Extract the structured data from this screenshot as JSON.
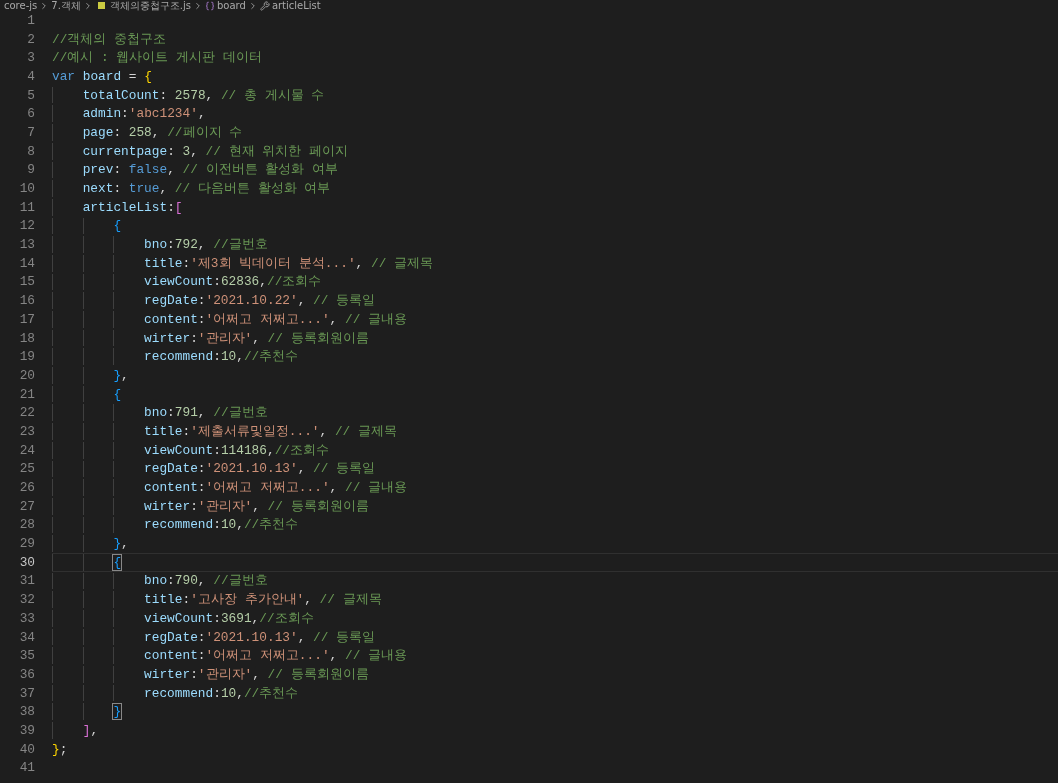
{
  "breadcrumb": [
    {
      "kind": "folder",
      "text": "core-js"
    },
    {
      "kind": "folder",
      "text": "7.객체"
    },
    {
      "kind": "file",
      "text": "객체의중첩구조.js"
    },
    {
      "kind": "variable",
      "text": "board"
    },
    {
      "kind": "property",
      "text": "articleList"
    }
  ],
  "editor": {
    "lines": [
      {
        "number": "1",
        "current": false
      },
      {
        "number": "2",
        "current": false,
        "tokens": [
          {
            "kind": "comment",
            "text": "//객체의 중첩구조"
          }
        ]
      },
      {
        "number": "3",
        "current": false,
        "tokens": [
          {
            "kind": "comment",
            "text": "//예시 : 웹사이트 게시판 데이터"
          }
        ]
      },
      {
        "number": "4",
        "current": false,
        "tokens": [
          {
            "kind": "keyword",
            "text": "var "
          },
          {
            "kind": "property",
            "text": "board"
          },
          {
            "kind": "punct",
            "text": " = "
          },
          {
            "kind": "bracket",
            "text": "{",
            "color": "#ffd700",
            "matched": false
          }
        ],
        "children": [
          {
            "number": "5",
            "current": false,
            "tokens": [
              {
                "kind": "property",
                "text": "totalCount"
              },
              {
                "kind": "punct",
                "text": ": "
              },
              {
                "kind": "number",
                "text": "2578"
              },
              {
                "kind": "punct",
                "text": ", "
              },
              {
                "kind": "comment",
                "text": "// 총 게시물 수"
              }
            ]
          },
          {
            "number": "6",
            "current": false,
            "tokens": [
              {
                "kind": "property",
                "text": "admin"
              },
              {
                "kind": "punct",
                "text": ":"
              },
              {
                "kind": "string",
                "text": "'abc1234'"
              },
              {
                "kind": "punct",
                "text": ","
              }
            ]
          },
          {
            "number": "7",
            "current": false,
            "tokens": [
              {
                "kind": "property",
                "text": "page"
              },
              {
                "kind": "punct",
                "text": ": "
              },
              {
                "kind": "number",
                "text": "258"
              },
              {
                "kind": "punct",
                "text": ", "
              },
              {
                "kind": "comment",
                "text": "//페이지 수"
              }
            ]
          },
          {
            "number": "8",
            "current": false,
            "tokens": [
              {
                "kind": "property",
                "text": "currentpage"
              },
              {
                "kind": "punct",
                "text": ": "
              },
              {
                "kind": "number",
                "text": "3"
              },
              {
                "kind": "punct",
                "text": ", "
              },
              {
                "kind": "comment",
                "text": "// 현재 위치한 페이지"
              }
            ]
          },
          {
            "number": "9",
            "current": false,
            "tokens": [
              {
                "kind": "property",
                "text": "prev"
              },
              {
                "kind": "punct",
                "text": ": "
              },
              {
                "kind": "keyword",
                "text": "false"
              },
              {
                "kind": "punct",
                "text": ", "
              },
              {
                "kind": "comment",
                "text": "// 이전버튼 활성화 여부"
              }
            ]
          },
          {
            "number": "10",
            "current": false,
            "tokens": [
              {
                "kind": "property",
                "text": "next"
              },
              {
                "kind": "punct",
                "text": ": "
              },
              {
                "kind": "keyword",
                "text": "true"
              },
              {
                "kind": "punct",
                "text": ", "
              },
              {
                "kind": "comment",
                "text": "// 다음버튼 활성화 여부"
              }
            ]
          },
          {
            "number": "11",
            "current": false,
            "tokens": [
              {
                "kind": "property",
                "text": "articleList"
              },
              {
                "kind": "punct",
                "text": ":"
              },
              {
                "kind": "bracket",
                "text": "[",
                "color": "#da70d6",
                "matched": false
              }
            ],
            "children": [
              {
                "number": "12",
                "current": false,
                "tokens": [
                  {
                    "kind": "bracket",
                    "text": "{",
                    "color": "#179fff",
                    "matched": false
                  }
                ],
                "children": [
                  {
                    "number": "13",
                    "current": false,
                    "tokens": [
                      {
                        "kind": "property",
                        "text": "bno"
                      },
                      {
                        "kind": "punct",
                        "text": ":"
                      },
                      {
                        "kind": "number",
                        "text": "792"
                      },
                      {
                        "kind": "punct",
                        "text": ", "
                      },
                      {
                        "kind": "comment",
                        "text": "//글번호"
                      }
                    ]
                  },
                  {
                    "number": "14",
                    "current": false,
                    "tokens": [
                      {
                        "kind": "property",
                        "text": "title"
                      },
                      {
                        "kind": "punct",
                        "text": ":"
                      },
                      {
                        "kind": "string",
                        "text": "'제3회 빅데이터 분석...'"
                      },
                      {
                        "kind": "punct",
                        "text": ", "
                      },
                      {
                        "kind": "comment",
                        "text": "// 글제목"
                      }
                    ]
                  },
                  {
                    "number": "15",
                    "current": false,
                    "tokens": [
                      {
                        "kind": "property",
                        "text": "viewCount"
                      },
                      {
                        "kind": "punct",
                        "text": ":"
                      },
                      {
                        "kind": "number",
                        "text": "62836"
                      },
                      {
                        "kind": "punct",
                        "text": ","
                      },
                      {
                        "kind": "comment",
                        "text": "//조회수"
                      }
                    ]
                  },
                  {
                    "number": "16",
                    "current": false,
                    "tokens": [
                      {
                        "kind": "property",
                        "text": "regDate"
                      },
                      {
                        "kind": "punct",
                        "text": ":"
                      },
                      {
                        "kind": "string",
                        "text": "'2021.10.22'"
                      },
                      {
                        "kind": "punct",
                        "text": ", "
                      },
                      {
                        "kind": "comment",
                        "text": "// 등록일"
                      }
                    ]
                  },
                  {
                    "number": "17",
                    "current": false,
                    "tokens": [
                      {
                        "kind": "property",
                        "text": "content"
                      },
                      {
                        "kind": "punct",
                        "text": ":"
                      },
                      {
                        "kind": "string",
                        "text": "'어쩌고 저쩌고...'"
                      },
                      {
                        "kind": "punct",
                        "text": ", "
                      },
                      {
                        "kind": "comment",
                        "text": "// 글내용"
                      }
                    ]
                  },
                  {
                    "number": "18",
                    "current": false,
                    "tokens": [
                      {
                        "kind": "property",
                        "text": "wirter"
                      },
                      {
                        "kind": "punct",
                        "text": ":"
                      },
                      {
                        "kind": "string",
                        "text": "'관리자'"
                      },
                      {
                        "kind": "punct",
                        "text": ", "
                      },
                      {
                        "kind": "comment",
                        "text": "// 등록회원이름"
                      }
                    ]
                  },
                  {
                    "number": "19",
                    "current": false,
                    "tokens": [
                      {
                        "kind": "property",
                        "text": "recommend"
                      },
                      {
                        "kind": "punct",
                        "text": ":"
                      },
                      {
                        "kind": "number",
                        "text": "10"
                      },
                      {
                        "kind": "punct",
                        "text": ","
                      },
                      {
                        "kind": "comment",
                        "text": "//추천수"
                      }
                    ]
                  }
                ]
              },
              {
                "number": "20",
                "current": false,
                "tokens": [
                  {
                    "kind": "bracket",
                    "text": "}",
                    "color": "#179fff",
                    "matched": false
                  },
                  {
                    "kind": "punct",
                    "text": ","
                  }
                ]
              },
              {
                "number": "21",
                "current": false,
                "tokens": [
                  {
                    "kind": "bracket",
                    "text": "{",
                    "color": "#179fff",
                    "matched": false
                  }
                ],
                "children": [
                  {
                    "number": "22",
                    "current": false,
                    "tokens": [
                      {
                        "kind": "property",
                        "text": "bno"
                      },
                      {
                        "kind": "punct",
                        "text": ":"
                      },
                      {
                        "kind": "number",
                        "text": "791"
                      },
                      {
                        "kind": "punct",
                        "text": ", "
                      },
                      {
                        "kind": "comment",
                        "text": "//글번호"
                      }
                    ]
                  },
                  {
                    "number": "23",
                    "current": false,
                    "tokens": [
                      {
                        "kind": "property",
                        "text": "title"
                      },
                      {
                        "kind": "punct",
                        "text": ":"
                      },
                      {
                        "kind": "string",
                        "text": "'제출서류및일정...'"
                      },
                      {
                        "kind": "punct",
                        "text": ", "
                      },
                      {
                        "kind": "comment",
                        "text": "// 글제목"
                      }
                    ]
                  },
                  {
                    "number": "24",
                    "current": false,
                    "tokens": [
                      {
                        "kind": "property",
                        "text": "viewCount"
                      },
                      {
                        "kind": "punct",
                        "text": ":"
                      },
                      {
                        "kind": "number",
                        "text": "114186"
                      },
                      {
                        "kind": "punct",
                        "text": ","
                      },
                      {
                        "kind": "comment",
                        "text": "//조회수"
                      }
                    ]
                  },
                  {
                    "number": "25",
                    "current": false,
                    "tokens": [
                      {
                        "kind": "property",
                        "text": "regDate"
                      },
                      {
                        "kind": "punct",
                        "text": ":"
                      },
                      {
                        "kind": "string",
                        "text": "'2021.10.13'"
                      },
                      {
                        "kind": "punct",
                        "text": ", "
                      },
                      {
                        "kind": "comment",
                        "text": "// 등록일"
                      }
                    ]
                  },
                  {
                    "number": "26",
                    "current": false,
                    "tokens": [
                      {
                        "kind": "property",
                        "text": "content"
                      },
                      {
                        "kind": "punct",
                        "text": ":"
                      },
                      {
                        "kind": "string",
                        "text": "'어쩌고 저쩌고...'"
                      },
                      {
                        "kind": "punct",
                        "text": ", "
                      },
                      {
                        "kind": "comment",
                        "text": "// 글내용"
                      }
                    ]
                  },
                  {
                    "number": "27",
                    "current": false,
                    "tokens": [
                      {
                        "kind": "property",
                        "text": "wirter"
                      },
                      {
                        "kind": "punct",
                        "text": ":"
                      },
                      {
                        "kind": "string",
                        "text": "'관리자'"
                      },
                      {
                        "kind": "punct",
                        "text": ", "
                      },
                      {
                        "kind": "comment",
                        "text": "// 등록회원이름"
                      }
                    ]
                  },
                  {
                    "number": "28",
                    "current": false,
                    "tokens": [
                      {
                        "kind": "property",
                        "text": "recommend"
                      },
                      {
                        "kind": "punct",
                        "text": ":"
                      },
                      {
                        "kind": "number",
                        "text": "10"
                      },
                      {
                        "kind": "punct",
                        "text": ","
                      },
                      {
                        "kind": "comment",
                        "text": "//추천수"
                      }
                    ]
                  }
                ]
              },
              {
                "number": "29",
                "current": false,
                "tokens": [
                  {
                    "kind": "bracket",
                    "text": "}",
                    "color": "#179fff",
                    "matched": false
                  },
                  {
                    "kind": "punct",
                    "text": ","
                  }
                ]
              },
              {
                "number": "30",
                "current": true,
                "tokens": [
                  {
                    "kind": "bracket",
                    "text": "{",
                    "color": "#179fff",
                    "matched": true
                  }
                ],
                "children": [
                  {
                    "number": "31",
                    "current": false,
                    "tokens": [
                      {
                        "kind": "property",
                        "text": "bno"
                      },
                      {
                        "kind": "punct",
                        "text": ":"
                      },
                      {
                        "kind": "number",
                        "text": "790"
                      },
                      {
                        "kind": "punct",
                        "text": ", "
                      },
                      {
                        "kind": "comment",
                        "text": "//글번호"
                      }
                    ]
                  },
                  {
                    "number": "32",
                    "current": false,
                    "tokens": [
                      {
                        "kind": "property",
                        "text": "title"
                      },
                      {
                        "kind": "punct",
                        "text": ":"
                      },
                      {
                        "kind": "string",
                        "text": "'고사장 추가안내'"
                      },
                      {
                        "kind": "punct",
                        "text": ", "
                      },
                      {
                        "kind": "comment",
                        "text": "// 글제목"
                      }
                    ]
                  },
                  {
                    "number": "33",
                    "current": false,
                    "tokens": [
                      {
                        "kind": "property",
                        "text": "viewCount"
                      },
                      {
                        "kind": "punct",
                        "text": ":"
                      },
                      {
                        "kind": "number",
                        "text": "3691"
                      },
                      {
                        "kind": "punct",
                        "text": ","
                      },
                      {
                        "kind": "comment",
                        "text": "//조회수"
                      }
                    ]
                  },
                  {
                    "number": "34",
                    "current": false,
                    "tokens": [
                      {
                        "kind": "property",
                        "text": "regDate"
                      },
                      {
                        "kind": "punct",
                        "text": ":"
                      },
                      {
                        "kind": "string",
                        "text": "'2021.10.13'"
                      },
                      {
                        "kind": "punct",
                        "text": ", "
                      },
                      {
                        "kind": "comment",
                        "text": "// 등록일"
                      }
                    ]
                  },
                  {
                    "number": "35",
                    "current": false,
                    "tokens": [
                      {
                        "kind": "property",
                        "text": "content"
                      },
                      {
                        "kind": "punct",
                        "text": ":"
                      },
                      {
                        "kind": "string",
                        "text": "'어쩌고 저쩌고...'"
                      },
                      {
                        "kind": "punct",
                        "text": ", "
                      },
                      {
                        "kind": "comment",
                        "text": "// 글내용"
                      }
                    ]
                  },
                  {
                    "number": "36",
                    "current": false,
                    "tokens": [
                      {
                        "kind": "property",
                        "text": "wirter"
                      },
                      {
                        "kind": "punct",
                        "text": ":"
                      },
                      {
                        "kind": "string",
                        "text": "'관리자'"
                      },
                      {
                        "kind": "punct",
                        "text": ", "
                      },
                      {
                        "kind": "comment",
                        "text": "// 등록회원이름"
                      }
                    ]
                  },
                  {
                    "number": "37",
                    "current": false,
                    "tokens": [
                      {
                        "kind": "property",
                        "text": "recommend"
                      },
                      {
                        "kind": "punct",
                        "text": ":"
                      },
                      {
                        "kind": "number",
                        "text": "10"
                      },
                      {
                        "kind": "punct",
                        "text": ","
                      },
                      {
                        "kind": "comment",
                        "text": "//추천수"
                      }
                    ]
                  }
                ]
              },
              {
                "number": "38",
                "current": false,
                "tokens": [
                  {
                    "kind": "bracket",
                    "text": "}",
                    "color": "#179fff",
                    "matched": true
                  }
                ]
              }
            ]
          },
          {
            "number": "39",
            "current": false,
            "tokens": [
              {
                "kind": "bracket",
                "text": "]",
                "color": "#da70d6",
                "matched": false
              },
              {
                "kind": "punct",
                "text": ","
              }
            ]
          }
        ]
      },
      {
        "number": "40",
        "current": false,
        "tokens": [
          {
            "kind": "bracket",
            "text": "}",
            "color": "#ffd700",
            "matched": false
          },
          {
            "kind": "punct",
            "text": ";"
          }
        ]
      },
      {
        "number": "41",
        "current": false
      }
    ]
  }
}
